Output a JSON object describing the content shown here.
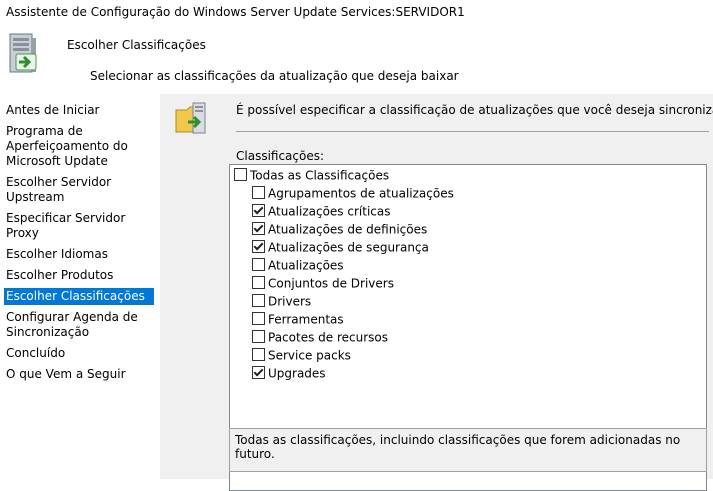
{
  "window": {
    "title": "Assistente de Configuração do Windows Server Update Services:SERVIDOR1"
  },
  "header": {
    "icon": "server-update-icon",
    "title": "Escolher Classificações",
    "subtitle": "Selecionar as classificações da atualização que deseja baixar"
  },
  "nav": {
    "items": [
      {
        "label": "Antes de Iniciar",
        "active": false
      },
      {
        "label": "Programa de Aperfeiçoamento do Microsoft Update",
        "active": false
      },
      {
        "label": "Escolher Servidor Upstream",
        "active": false
      },
      {
        "label": "Especificar Servidor Proxy",
        "active": false
      },
      {
        "label": "Escolher Idiomas",
        "active": false
      },
      {
        "label": "Escolher Produtos",
        "active": false
      },
      {
        "label": "Escolher Classificações",
        "active": true
      },
      {
        "label": "Configurar Agenda de Sincronização",
        "active": false
      },
      {
        "label": "Concluído",
        "active": false
      },
      {
        "label": "O que Vem a Seguir",
        "active": false
      }
    ]
  },
  "main": {
    "icon": "folder-update-icon",
    "intro": "É possível especificar a classificação de atualizações que você deseja sincronizar.",
    "list_label": "Classificações:",
    "all": {
      "label": "Todas as Classificações",
      "checked": false
    },
    "classifications": [
      {
        "label": "Agrupamentos de atualizações",
        "checked": false
      },
      {
        "label": "Atualizações críticas",
        "checked": true
      },
      {
        "label": "Atualizações de definições",
        "checked": true
      },
      {
        "label": "Atualizações de segurança",
        "checked": true
      },
      {
        "label": "Atualizações",
        "checked": false
      },
      {
        "label": "Conjuntos de Drivers",
        "checked": false
      },
      {
        "label": "Drivers",
        "checked": false
      },
      {
        "label": "Ferramentas",
        "checked": false
      },
      {
        "label": "Pacotes de recursos",
        "checked": false
      },
      {
        "label": "Service packs",
        "checked": false
      },
      {
        "label": "Upgrades",
        "checked": true
      }
    ],
    "description": "Todas as classificações, incluindo classificações que forem adicionadas no futuro."
  }
}
